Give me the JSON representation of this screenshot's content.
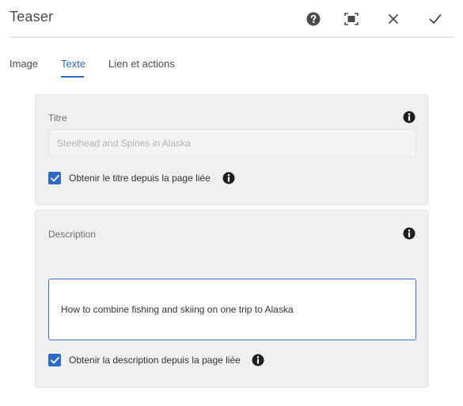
{
  "dialog": {
    "title": "Teaser",
    "actions": [
      "help-icon",
      "fullscreen-icon",
      "close-icon",
      "checkmark-icon"
    ]
  },
  "tabs": [
    {
      "label": "Image",
      "active": false
    },
    {
      "label": "Texte",
      "active": true
    },
    {
      "label": "Lien et actions",
      "active": false
    }
  ],
  "title_section": {
    "label": "Titre",
    "value": "Steelhead and Spines in Alaska",
    "disabled": true,
    "checkbox_label": "Obtenir le titre depuis la page liée",
    "checked": true
  },
  "description_section": {
    "label": "Description",
    "value": "How to combine fishing and skiing on one trip to Alaska",
    "checkbox_label": "Obtenir la description depuis la page liée",
    "checked": true
  },
  "colors": {
    "accent": "#2d69c6",
    "panel_bg": "#f0f0f0",
    "text": "#4b4b4b"
  }
}
